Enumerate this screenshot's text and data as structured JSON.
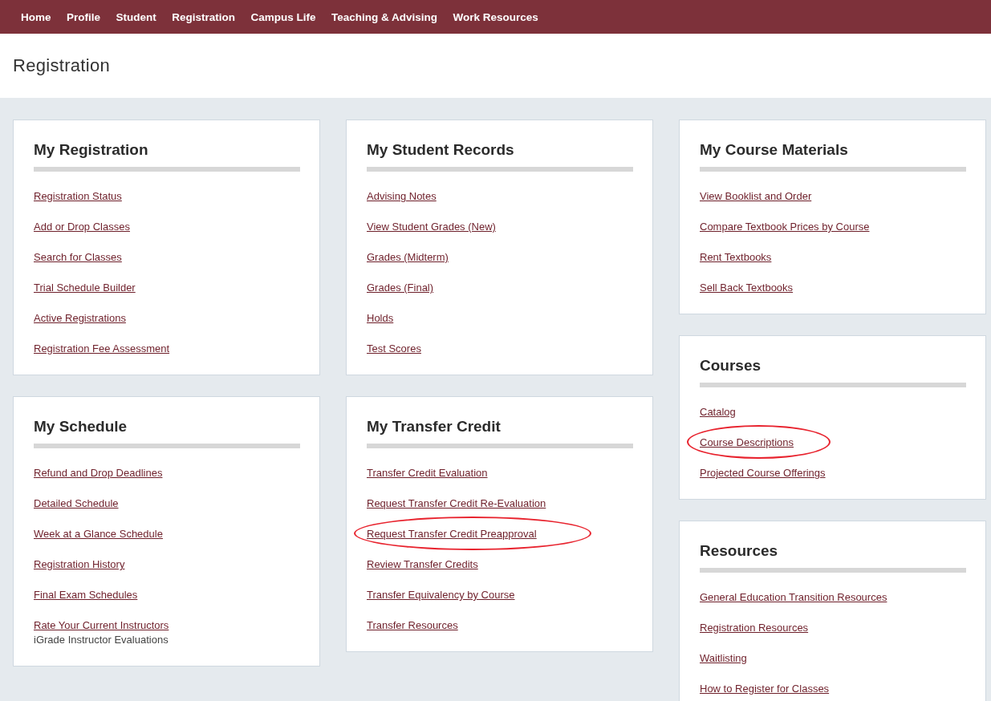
{
  "nav": {
    "items": [
      {
        "label": "Home"
      },
      {
        "label": "Profile"
      },
      {
        "label": "Student"
      },
      {
        "label": "Registration"
      },
      {
        "label": "Campus Life"
      },
      {
        "label": "Teaching & Advising"
      },
      {
        "label": "Work Resources"
      }
    ]
  },
  "page_title": "Registration",
  "columns": [
    {
      "cards": [
        {
          "title": "My Registration",
          "items": [
            {
              "kind": "link",
              "label": "Registration Status",
              "circled": false
            },
            {
              "kind": "link",
              "label": "Add or Drop Classes",
              "circled": false
            },
            {
              "kind": "link",
              "label": "Search for Classes",
              "circled": false
            },
            {
              "kind": "link",
              "label": "Trial Schedule Builder",
              "circled": false
            },
            {
              "kind": "link",
              "label": "Active Registrations",
              "circled": false
            },
            {
              "kind": "link",
              "label": "Registration Fee Assessment",
              "circled": false
            }
          ]
        },
        {
          "title": "My Schedule",
          "items": [
            {
              "kind": "link",
              "label": "Refund and Drop Deadlines",
              "circled": false
            },
            {
              "kind": "link",
              "label": "Detailed Schedule",
              "circled": false
            },
            {
              "kind": "link",
              "label": "Week at a Glance Schedule",
              "circled": false
            },
            {
              "kind": "link",
              "label": "Registration History",
              "circled": false
            },
            {
              "kind": "link",
              "label": "Final Exam Schedules",
              "circled": false
            },
            {
              "kind": "link",
              "label": "Rate Your Current Instructors",
              "circled": false
            },
            {
              "kind": "note",
              "label": "iGrade Instructor Evaluations"
            }
          ]
        }
      ]
    },
    {
      "cards": [
        {
          "title": "My Student Records",
          "items": [
            {
              "kind": "link",
              "label": "Advising Notes",
              "circled": false
            },
            {
              "kind": "link",
              "label": "View Student Grades (New)",
              "circled": false
            },
            {
              "kind": "link",
              "label": "Grades (Midterm)",
              "circled": false
            },
            {
              "kind": "link",
              "label": "Grades (Final)",
              "circled": false
            },
            {
              "kind": "link",
              "label": "Holds",
              "circled": false
            },
            {
              "kind": "link",
              "label": "Test Scores",
              "circled": false
            }
          ]
        },
        {
          "title": "My Transfer Credit",
          "items": [
            {
              "kind": "link",
              "label": "Transfer Credit Evaluation",
              "circled": false
            },
            {
              "kind": "link",
              "label": "Request Transfer Credit Re-Evaluation",
              "circled": false
            },
            {
              "kind": "link",
              "label": "Request Transfer Credit Preapproval",
              "circled": true
            },
            {
              "kind": "link",
              "label": "Review Transfer Credits",
              "circled": false
            },
            {
              "kind": "link",
              "label": "Transfer Equivalency by Course",
              "circled": false
            },
            {
              "kind": "link",
              "label": "Transfer Resources",
              "circled": false
            }
          ]
        }
      ]
    },
    {
      "cards": [
        {
          "title": "My Course Materials",
          "items": [
            {
              "kind": "link",
              "label": "View Booklist and Order",
              "circled": false
            },
            {
              "kind": "link",
              "label": "Compare Textbook Prices by Course",
              "circled": false
            },
            {
              "kind": "link",
              "label": "Rent Textbooks",
              "circled": false
            },
            {
              "kind": "link",
              "label": "Sell Back Textbooks",
              "circled": false
            }
          ]
        },
        {
          "title": "Courses",
          "items": [
            {
              "kind": "link",
              "label": "Catalog",
              "circled": false
            },
            {
              "kind": "link",
              "label": "Course Descriptions",
              "circled": true
            },
            {
              "kind": "link",
              "label": "Projected Course Offerings",
              "circled": false
            }
          ]
        },
        {
          "title": "Resources",
          "items": [
            {
              "kind": "link",
              "label": "General Education Transition Resources",
              "circled": false
            },
            {
              "kind": "link",
              "label": "Registration Resources",
              "circled": false
            },
            {
              "kind": "link",
              "label": "Waitlisting",
              "circled": false
            },
            {
              "kind": "link",
              "label": "How to Register for Classes",
              "circled": false
            }
          ]
        }
      ]
    }
  ]
}
